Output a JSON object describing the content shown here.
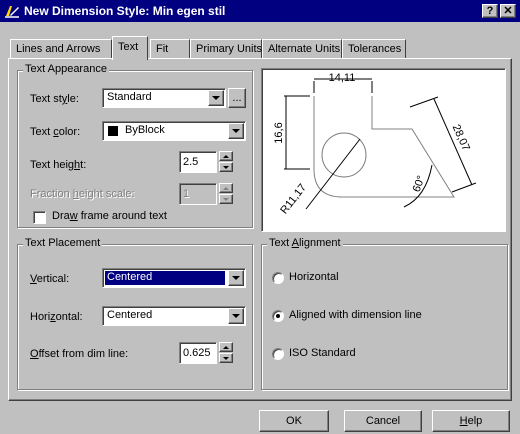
{
  "window": {
    "title": "New Dimension Style: Min egen stil",
    "help_button": "?",
    "close_button": "✕"
  },
  "tabs": [
    {
      "label": "Lines and Arrows"
    },
    {
      "label": "Text"
    },
    {
      "label": "Fit"
    },
    {
      "label": "Primary Units"
    },
    {
      "label": "Alternate Units"
    },
    {
      "label": "Tolerances"
    }
  ],
  "text_appearance": {
    "group_label": "Text Appearance",
    "text_style": {
      "label_pre": "Text st",
      "label_key": "y",
      "label_post": "le:",
      "value": "Standard",
      "browse": "..."
    },
    "text_color": {
      "label_pre": "Text ",
      "label_key": "c",
      "label_post": "olor:",
      "value": "ByBlock",
      "swatch_color": "#000000"
    },
    "text_height": {
      "label_pre": "Text heig",
      "label_key": "h",
      "label_post": "t:",
      "value": "2.5"
    },
    "fraction_height": {
      "label_pre": "Fraction ",
      "label_key": "h",
      "label_post": "eight scale:",
      "value": "1"
    },
    "draw_frame": {
      "label_pre": "Dra",
      "label_key": "w",
      "label_post": " frame around text",
      "checked": false
    }
  },
  "preview": {
    "dim_top": "14,11",
    "dim_left": "16,6",
    "dim_right": "28,07",
    "dim_angle": "60°",
    "dim_radius": "R11,17"
  },
  "text_placement": {
    "group_label": "Text Placement",
    "vertical": {
      "label_key": "V",
      "label_post": "ertical:",
      "value": "Centered"
    },
    "horizontal": {
      "label_pre": "Hori",
      "label_key": "z",
      "label_post": "ontal:",
      "value": "Centered"
    },
    "offset": {
      "label_key": "O",
      "label_post": "ffset from dim line:",
      "value": "0.625"
    }
  },
  "text_alignment": {
    "group_label_pre": "Text ",
    "group_label_key": "A",
    "group_label_post": "lignment",
    "options": [
      {
        "label": "Horizontal",
        "selected": false
      },
      {
        "label": "Aligned with dimension line",
        "selected": true
      },
      {
        "label": "ISO Standard",
        "selected": false
      }
    ]
  },
  "buttons": {
    "ok": "OK",
    "cancel": "Cancel",
    "help_key": "H",
    "help_rest": "elp"
  }
}
